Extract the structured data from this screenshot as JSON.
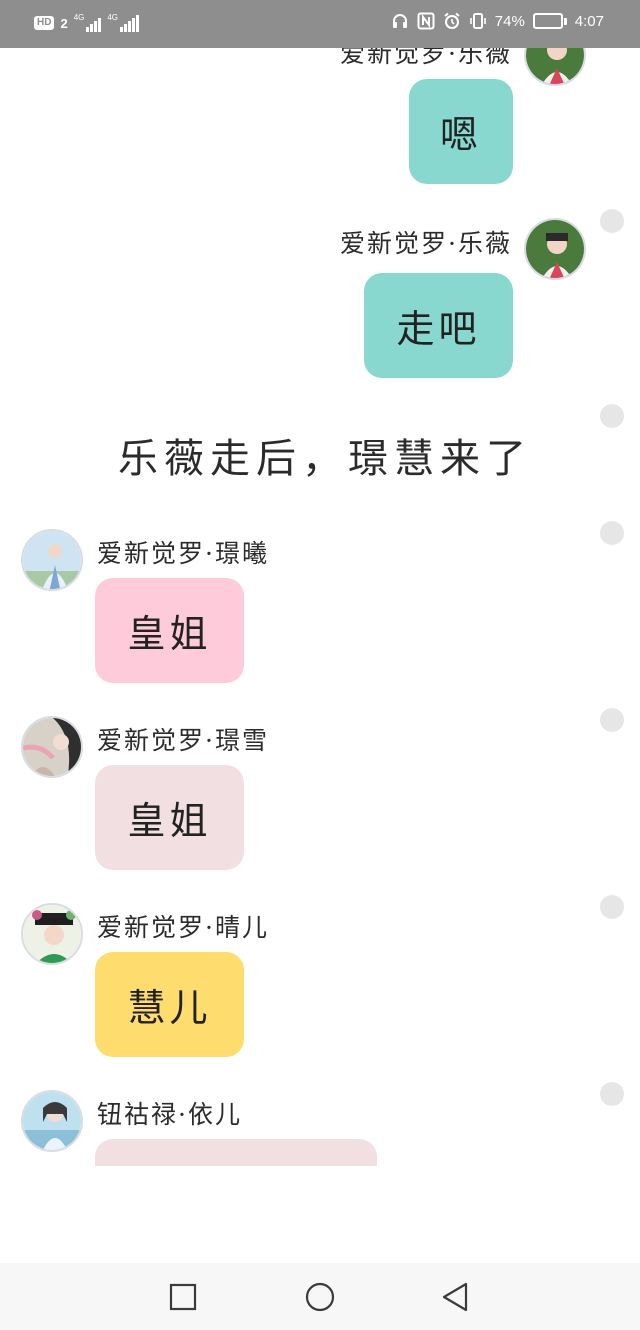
{
  "status_bar": {
    "hd_label": "HD",
    "sim_number": "2",
    "network_1": "4G",
    "network_2": "4G",
    "battery_percent": "74%",
    "battery_level": 0.74,
    "time": "4:07",
    "icons": [
      "headphones-icon",
      "nfc-icon",
      "alarm-icon",
      "vibrate-icon",
      "battery-icon"
    ]
  },
  "chat": {
    "messages": [
      {
        "side": "right",
        "sender": "爱新觉罗·乐薇",
        "text": "嗯",
        "bubble_color": "#88d8cf"
      },
      {
        "side": "right",
        "sender": "爱新觉罗·乐薇",
        "text": "走吧",
        "bubble_color": "#88d8cf"
      },
      {
        "side": "right",
        "sender": "爱新觉罗·璟曦",
        "text": "皇姐",
        "bubble_color": "#fdcbd9"
      },
      {
        "side": "left",
        "sender": "爱新觉罗·璟雪",
        "text": "皇姐",
        "bubble_color": "#f2dfe1"
      },
      {
        "side": "left",
        "sender": "爱新觉罗·晴儿",
        "text": "慧儿",
        "bubble_color": "#fedc6e"
      },
      {
        "side": "left",
        "sender": "钮祜禄·依儿",
        "text": "",
        "bubble_color": "#f2dfe1"
      }
    ],
    "narration": "乐薇走后，璟慧来了"
  },
  "nav_bar": {
    "icons": [
      "recent-apps-icon",
      "home-icon",
      "back-icon"
    ]
  },
  "colors": {
    "status_bar_bg": "#8e8e8e",
    "nav_bar_bg": "#f7f7f7"
  }
}
